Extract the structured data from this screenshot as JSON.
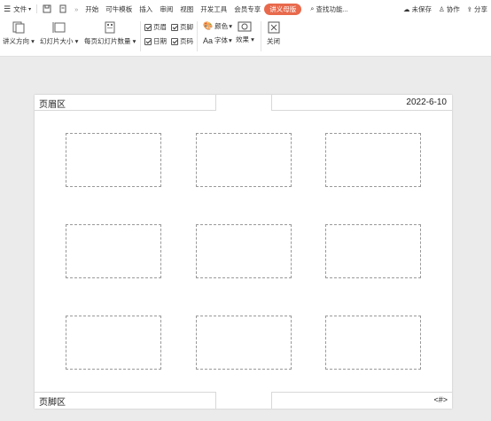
{
  "menubar": {
    "file": "文件",
    "tabs": [
      "开始",
      "可牛模板",
      "插入",
      "审阅",
      "视图",
      "开发工具",
      "会员专享"
    ],
    "active_tab": "讲义母版",
    "search": "查找功能...",
    "unsaved": "未保存",
    "collaborate": "协作",
    "share": "分享"
  },
  "ribbon": {
    "handout_orientation": "讲义方向",
    "slide_size": "幻灯片大小",
    "slides_per_page": "每页幻灯片数量",
    "header": "页眉",
    "footer": "页脚",
    "date": "日期",
    "page_number": "页码",
    "color": "颜色",
    "font_prefix": "Aa",
    "font": "字体",
    "effect": "效果",
    "close": "关闭"
  },
  "page": {
    "header_area": "页眉区",
    "date_value": "2022-6-10",
    "footer_area": "页脚区",
    "page_number_field": "<#>"
  },
  "colors": {
    "accent": "#e8694c"
  }
}
